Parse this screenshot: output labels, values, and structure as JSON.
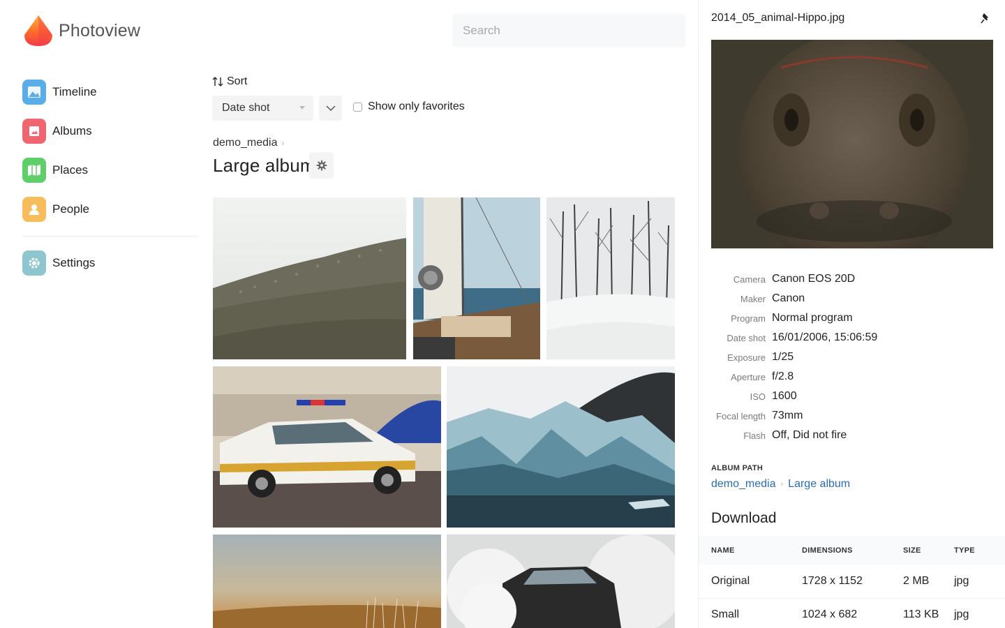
{
  "app": {
    "name": "Photoview"
  },
  "sidebar": {
    "items": [
      {
        "label": "Timeline",
        "icon": "timeline-icon"
      },
      {
        "label": "Albums",
        "icon": "albums-icon"
      },
      {
        "label": "Places",
        "icon": "places-icon"
      },
      {
        "label": "People",
        "icon": "people-icon"
      }
    ],
    "settings": {
      "label": "Settings",
      "icon": "gear-icon"
    }
  },
  "search": {
    "placeholder": "Search"
  },
  "controls": {
    "sort_label": "Sort",
    "sort_value": "Date shot",
    "favorites_label": "Show only favorites",
    "favorites_checked": false
  },
  "album": {
    "breadcrumb": "demo_media",
    "title": "Large album"
  },
  "photos": [
    {
      "subject": "hillside with sheep"
    },
    {
      "subject": "sailboat deck"
    },
    {
      "subject": "snowy forest"
    },
    {
      "subject": "police car"
    },
    {
      "subject": "glacier"
    },
    {
      "subject": "sunset field"
    },
    {
      "subject": "car burnout smoke"
    }
  ],
  "details": {
    "filename": "2014_05_animal-Hippo.jpg",
    "exif": [
      {
        "key": "Camera",
        "value": "Canon EOS 20D"
      },
      {
        "key": "Maker",
        "value": "Canon"
      },
      {
        "key": "Program",
        "value": "Normal program"
      },
      {
        "key": "Date shot",
        "value": "16/01/2006, 15:06:59"
      },
      {
        "key": "Exposure",
        "value": "1/25"
      },
      {
        "key": "Aperture",
        "value": "f/2.8"
      },
      {
        "key": "ISO",
        "value": "1600"
      },
      {
        "key": "Focal length",
        "value": "73mm"
      },
      {
        "key": "Flash",
        "value": "Off, Did not fire"
      }
    ],
    "album_path": {
      "heading": "ALBUM PATH",
      "parts": [
        "demo_media",
        "Large album"
      ]
    },
    "download": {
      "title": "Download",
      "headers": [
        "NAME",
        "DIMENSIONS",
        "SIZE",
        "TYPE"
      ],
      "rows": [
        {
          "name": "Original",
          "dimensions": "1728 x 1152",
          "size": "2 MB",
          "type": "jpg"
        },
        {
          "name": "Small",
          "dimensions": "1024 x 682",
          "size": "113 KB",
          "type": "jpg"
        }
      ]
    }
  },
  "colors": {
    "link": "#2b6cb0",
    "timeline": "#5aaee8",
    "albums": "#ef6670",
    "places": "#5fcf6a",
    "people": "#f7bd5c",
    "settings": "#8ec6cf"
  }
}
